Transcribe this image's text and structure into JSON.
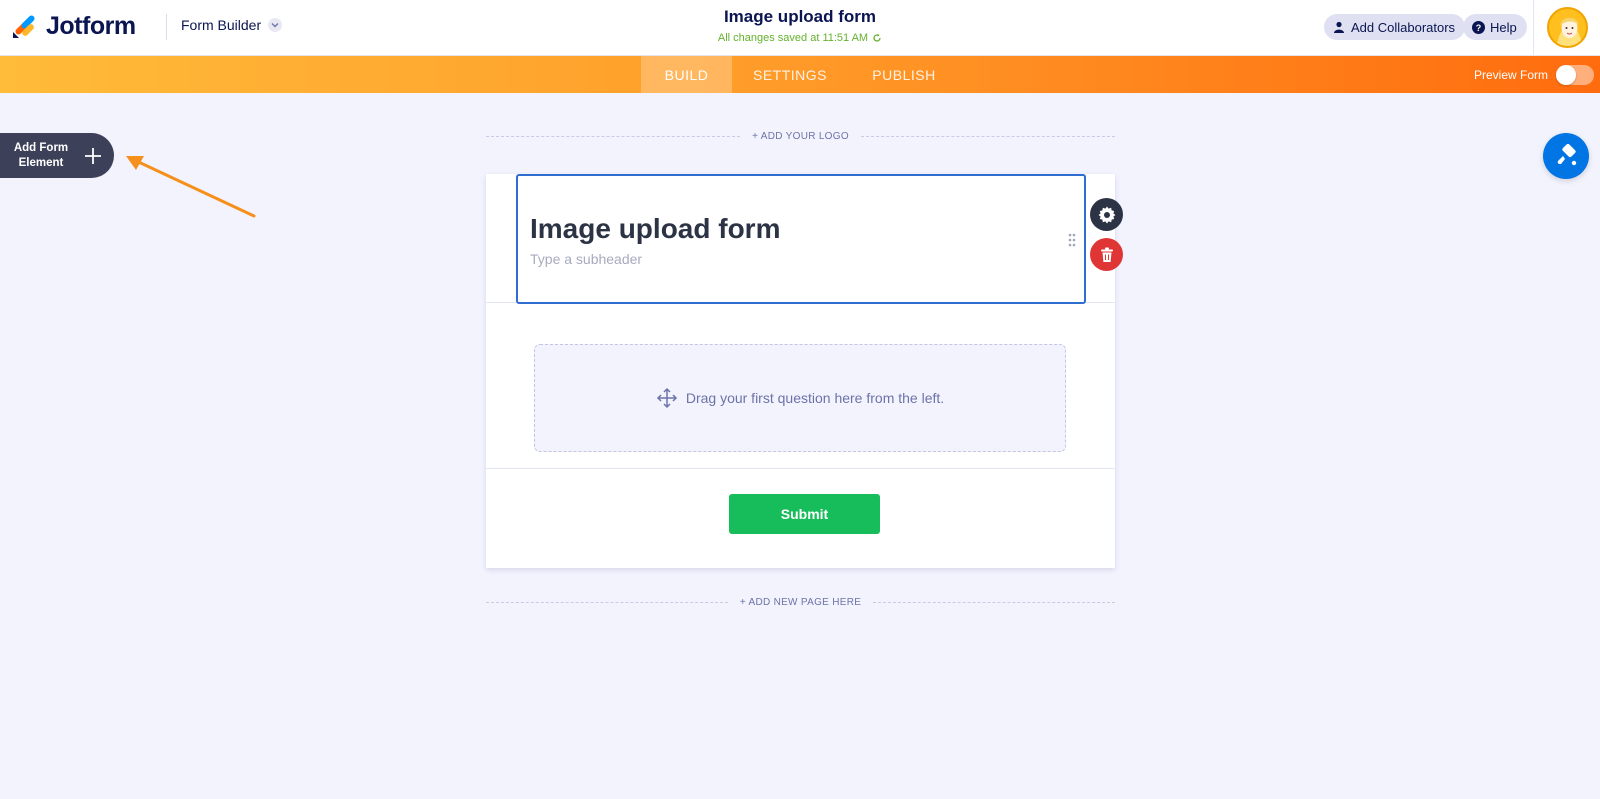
{
  "header": {
    "brand": "Jotform",
    "builder_menu": "Form Builder",
    "form_title": "Image upload form",
    "save_status": "All changes saved at 11:51 AM",
    "add_collaborators": "Add Collaborators",
    "help": "Help"
  },
  "nav": {
    "tabs": [
      {
        "label": "BUILD",
        "active": true
      },
      {
        "label": "SETTINGS",
        "active": false
      },
      {
        "label": "PUBLISH",
        "active": false
      }
    ],
    "preview_label": "Preview Form",
    "preview_enabled": false
  },
  "sidebar": {
    "add_element_label": "Add Form Element"
  },
  "canvas": {
    "add_logo": "+ ADD YOUR LOGO",
    "add_page": "+ ADD NEW PAGE HERE"
  },
  "form": {
    "heading": "Image upload form",
    "subheader_placeholder": "Type a subheader",
    "dropzone_text": "Drag your first question here from the left.",
    "submit_label": "Submit"
  },
  "colors": {
    "brand_navy": "#0a1551",
    "nav_orange_start": "#ffbb3a",
    "nav_orange_end": "#ff6c0f",
    "submit_green": "#18bd5b",
    "accent_blue": "#0075e3",
    "delete_red": "#e03535",
    "save_green": "#64b22e"
  },
  "icons": [
    "jotform-logo-icon",
    "chevron-down-icon",
    "refresh-icon",
    "user-icon",
    "help-icon",
    "avatar",
    "plus-icon",
    "arrow-annotation",
    "paint-roller-icon",
    "drag-handle-icon",
    "gear-icon",
    "trash-icon",
    "move-icon"
  ]
}
